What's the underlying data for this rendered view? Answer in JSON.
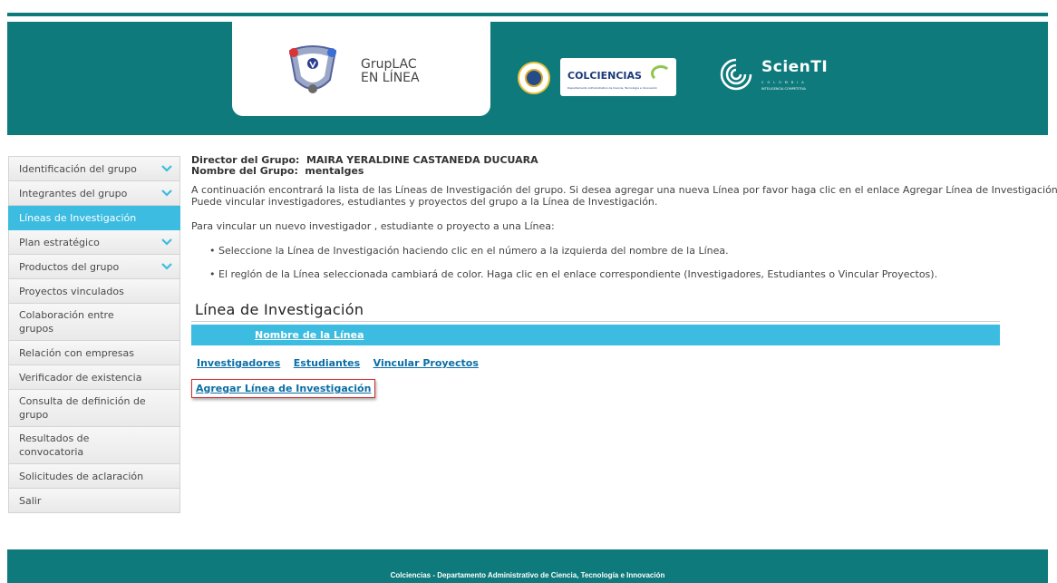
{
  "header": {
    "logo_line1": "GrupLAC",
    "logo_line2": "EN LÍNEA",
    "colciencias_label": "COLCIENCIAS",
    "colciencias_sub": "Departamento Administrativo de Ciencia, Tecnología e Innovación",
    "scienti_label": "ScienTI",
    "scienti_sub1": "COLOMBIA",
    "scienti_sub2": "INTELIGENCIA COMPETITIVA"
  },
  "sidebar": {
    "items": [
      {
        "label": "Identificación del grupo",
        "chevron": true,
        "active": false
      },
      {
        "label": "Integrantes del grupo",
        "chevron": true,
        "active": false
      },
      {
        "label": "Líneas de Investigación",
        "chevron": false,
        "active": true
      },
      {
        "label": "Plan estratégico",
        "chevron": true,
        "active": false
      },
      {
        "label": "Productos del grupo",
        "chevron": true,
        "active": false
      },
      {
        "label": "Proyectos vinculados",
        "chevron": false,
        "active": false
      },
      {
        "label": "Colaboración entre grupos",
        "chevron": false,
        "active": false
      },
      {
        "label": "Relación con empresas",
        "chevron": false,
        "active": false
      },
      {
        "label": "Verificador de existencia",
        "chevron": false,
        "active": false
      },
      {
        "label": "Consulta de definición de grupo",
        "chevron": false,
        "active": false
      },
      {
        "label": "Resultados de convocatoria",
        "chevron": false,
        "active": false
      },
      {
        "label": "Solicitudes de aclaración",
        "chevron": false,
        "active": false
      },
      {
        "label": "Salir",
        "chevron": false,
        "active": false
      }
    ]
  },
  "main": {
    "director_label": "Director del Grupo:",
    "director_value": "MAIRA YERALDINE CASTANEDA DUCUARA",
    "group_label": "Nombre del Grupo:",
    "group_value": "mentalges",
    "intro_line1": "A continuación encontrará la lista de las Líneas de Investigación del grupo. Si desea agregar una nueva Línea por favor haga clic en el enlace Agregar Línea de Investigación.",
    "intro_line2": "Puede vincular investigadores, estudiantes y proyectos del grupo a la Línea de Investigación.",
    "instruction": "Para vincular un nuevo investigador , estudiante o proyecto a una Línea:",
    "bullets": [
      "Seleccione la Línea de Investigación haciendo clic en el número a la izquierda del nombre de la Línea.",
      "El reglón de la Línea seleccionada cambiará de color. Haga clic en el enlace correspondiente (Investigadores, Estudiantes o Vincular Proyectos)."
    ],
    "section_title": "Línea de Investigación",
    "table_header": "Nombre de la Línea",
    "link_investigadores": "Investigadores",
    "link_estudiantes": "Estudiantes",
    "link_vincular": "Vincular Proyectos",
    "link_agregar": "Agregar Línea de Investigación"
  },
  "footer": {
    "text": "Colciencias - Departamento Administrativo de Ciencia, Tecnología e Innovación"
  },
  "colors": {
    "brand_teal": "#0e7a7c",
    "accent_blue": "#3bbce0",
    "link_blue": "#0a6ea6"
  }
}
